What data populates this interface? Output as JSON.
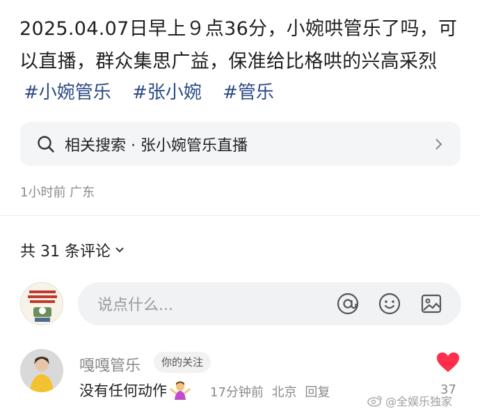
{
  "post": {
    "text": "2025.04.07日早上９点36分，小婉哄管乐了吗，可以直播，群众集思广益，保准给比格哄的兴高采烈",
    "hashtags": [
      "#小婉管乐",
      "#张小婉",
      "#管乐"
    ]
  },
  "related_search": {
    "label": "相关搜索 · 张小婉管乐直播"
  },
  "meta": {
    "time_location": "1小时前 广东"
  },
  "comments_header": {
    "count_label": "共 31 条评论"
  },
  "comment_input": {
    "placeholder": "说点什么..."
  },
  "comments": [
    {
      "author": "嘎嘎管乐",
      "badge": "你的关注",
      "text": "没有任何动作",
      "time": "17分钟前",
      "location": "北京",
      "reply_label": "回复",
      "like_count": "37",
      "liked": true
    }
  ],
  "watermark": {
    "text": "@全娱乐独家"
  },
  "colors": {
    "hashtag": "#2b4a85",
    "like": "#ff2e4d"
  }
}
